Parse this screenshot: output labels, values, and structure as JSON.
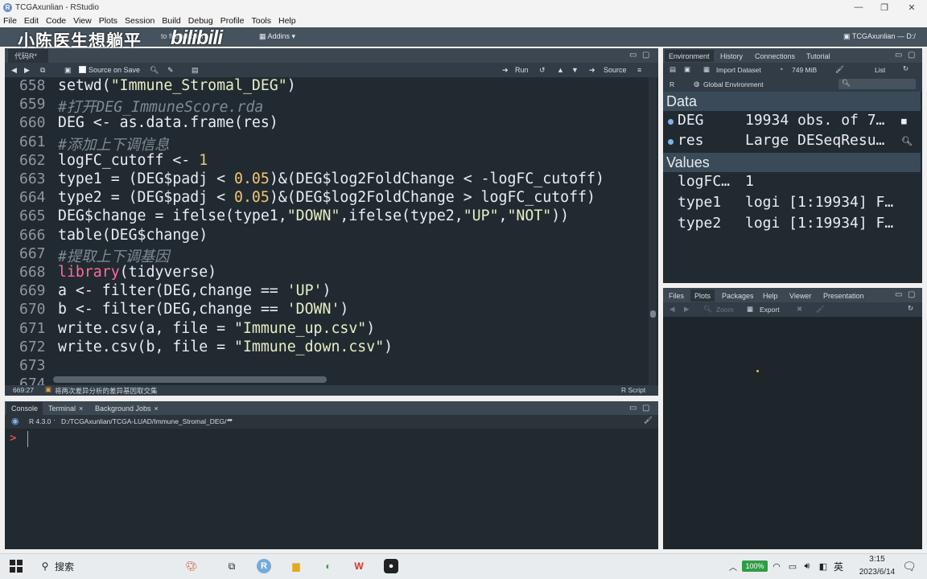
{
  "window": {
    "title": "TCGAxunlian - RStudio",
    "logo": "R"
  },
  "menu": [
    "File",
    "Edit",
    "Code",
    "View",
    "Plots",
    "Session",
    "Build",
    "Debug",
    "Profile",
    "Tools",
    "Help"
  ],
  "overlay": {
    "watermark": "小陈医生想躺平",
    "bili": "bilibili"
  },
  "toolbar": {
    "goto": "to file/function",
    "addins": "Addins",
    "project": "TCGAxunlian — D:/"
  },
  "editor": {
    "tab": "代码R*",
    "source_on_save": "Source on Save",
    "run": "Run",
    "source": "Source",
    "lines": [
      {
        "n": "658",
        "parts": [
          {
            "t": "setwd(",
            "c": ""
          },
          {
            "t": "\"Immune_Stromal_DEG\"",
            "c": "str"
          },
          {
            "t": ")",
            "c": ""
          }
        ]
      },
      {
        "n": "659",
        "parts": [
          {
            "t": "#打开DEG_ImmuneScore.rda",
            "c": "cmt"
          }
        ]
      },
      {
        "n": "660",
        "parts": [
          {
            "t": "DEG <- as.data.frame(res)",
            "c": ""
          }
        ]
      },
      {
        "n": "661",
        "parts": [
          {
            "t": "#添加上下调信息",
            "c": "cmt"
          }
        ]
      },
      {
        "n": "662",
        "parts": [
          {
            "t": "logFC_cutoff <- ",
            "c": ""
          },
          {
            "t": "1",
            "c": "num"
          }
        ]
      },
      {
        "n": "663",
        "parts": [
          {
            "t": "type1 = (DEG$padj < ",
            "c": ""
          },
          {
            "t": "0.05",
            "c": "num"
          },
          {
            "t": ")&(DEG$log2FoldChange < -logFC_cutoff)",
            "c": ""
          }
        ]
      },
      {
        "n": "664",
        "parts": [
          {
            "t": "type2 = (DEG$padj < ",
            "c": ""
          },
          {
            "t": "0.05",
            "c": "num"
          },
          {
            "t": ")&(DEG$log2FoldChange > logFC_cutoff)",
            "c": ""
          }
        ]
      },
      {
        "n": "665",
        "parts": [
          {
            "t": "DEG$change = ifelse(type1,",
            "c": ""
          },
          {
            "t": "\"DOWN\"",
            "c": "str"
          },
          {
            "t": ",ifelse(type2,",
            "c": ""
          },
          {
            "t": "\"UP\"",
            "c": "str"
          },
          {
            "t": ",",
            "c": ""
          },
          {
            "t": "\"NOT\"",
            "c": "str"
          },
          {
            "t": "))",
            "c": ""
          }
        ]
      },
      {
        "n": "666",
        "parts": [
          {
            "t": "table(DEG$change)",
            "c": ""
          }
        ]
      },
      {
        "n": "667",
        "parts": [
          {
            "t": "#提取上下调基因",
            "c": "cmt"
          }
        ]
      },
      {
        "n": "668",
        "parts": [
          {
            "t": "library",
            "c": "kw"
          },
          {
            "t": "(tidyverse)",
            "c": ""
          }
        ]
      },
      {
        "n": "669",
        "parts": [
          {
            "t": "a <- filter(DEG,change == ",
            "c": ""
          },
          {
            "t": "'UP'",
            "c": "str"
          },
          {
            "t": ")",
            "c": ""
          }
        ]
      },
      {
        "n": "670",
        "parts": [
          {
            "t": "b <- filter(DEG,change == ",
            "c": ""
          },
          {
            "t": "'DOWN'",
            "c": "str"
          },
          {
            "t": ")",
            "c": ""
          }
        ]
      },
      {
        "n": "671",
        "parts": [
          {
            "t": "write.csv(a, file = ",
            "c": ""
          },
          {
            "t": "\"Immune_up.csv\"",
            "c": "str"
          },
          {
            "t": ")",
            "c": ""
          }
        ]
      },
      {
        "n": "672",
        "parts": [
          {
            "t": "write.csv(b, file = ",
            "c": ""
          },
          {
            "t": "\"Immune_down.csv\"",
            "c": "str"
          },
          {
            "t": ")",
            "c": ""
          }
        ]
      },
      {
        "n": "673",
        "parts": []
      },
      {
        "n": "674",
        "parts": []
      }
    ],
    "status_pos": "669:27",
    "status_section": "将两次差异分析的差异基因取交集",
    "status_lang": "R Script"
  },
  "console": {
    "tabs": [
      "Console",
      "Terminal",
      "Background Jobs"
    ],
    "version": "R 4.3.0",
    "path": "D:/TCGAxunlian/TCGA-LUAD/Immune_Stromal_DEG/",
    "prompt": ">"
  },
  "environment": {
    "tabs": [
      "Environment",
      "History",
      "Connections",
      "Tutorial"
    ],
    "import": "Import Dataset",
    "memory": "749 MiB",
    "list": "List",
    "lang": "R",
    "scope": "Global Environment",
    "data_header": "Data",
    "values_header": "Values",
    "data": [
      {
        "name": "DEG",
        "value": "19934 obs. of 7…"
      },
      {
        "name": "res",
        "value": "Large DESeqResu…"
      }
    ],
    "values": [
      {
        "name": "logFC…",
        "value": "1"
      },
      {
        "name": "type1",
        "value": "logi [1:19934] F…"
      },
      {
        "name": "type2",
        "value": "logi [1:19934] F…"
      }
    ]
  },
  "files": {
    "tabs": [
      "Files",
      "Plots",
      "Packages",
      "Help",
      "Viewer",
      "Presentation"
    ],
    "zoom": "Zoom",
    "export": "Export"
  },
  "taskbar": {
    "search": "搜索",
    "battery": "100%",
    "ime": "英",
    "time": "3:15",
    "date": "2023/6/14"
  }
}
